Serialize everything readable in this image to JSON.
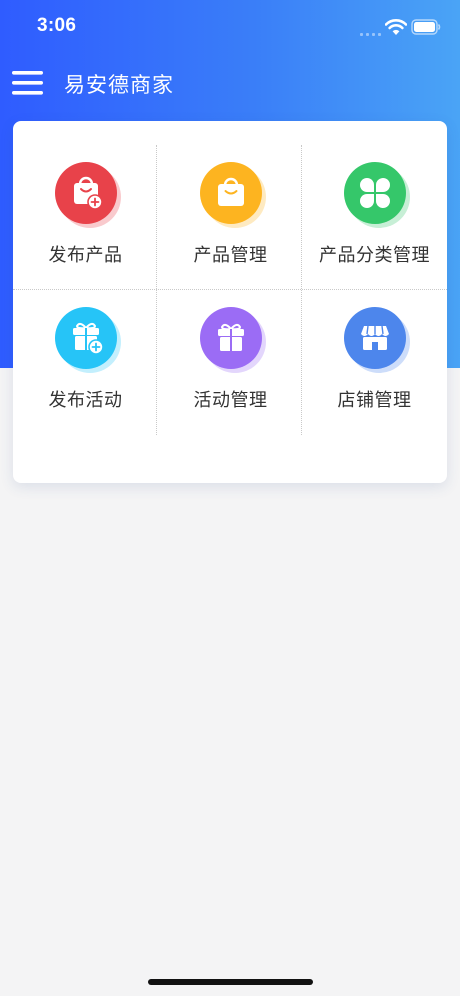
{
  "status_bar": {
    "time": "3:06"
  },
  "nav": {
    "title": "易安德商家"
  },
  "menu": [
    {
      "label": "发布产品",
      "icon": "bag-add-icon",
      "color": "#e8424a"
    },
    {
      "label": "产品管理",
      "icon": "bag-icon",
      "color": "#fdb420"
    },
    {
      "label": "产品分类管理",
      "icon": "clover-icon",
      "color": "#35c76a"
    },
    {
      "label": "发布活动",
      "icon": "gift-add-icon",
      "color": "#26c4f7"
    },
    {
      "label": "活动管理",
      "icon": "gift-icon",
      "color": "#9b6cf5"
    },
    {
      "label": "店铺管理",
      "icon": "store-icon",
      "color": "#4d86ec"
    }
  ]
}
